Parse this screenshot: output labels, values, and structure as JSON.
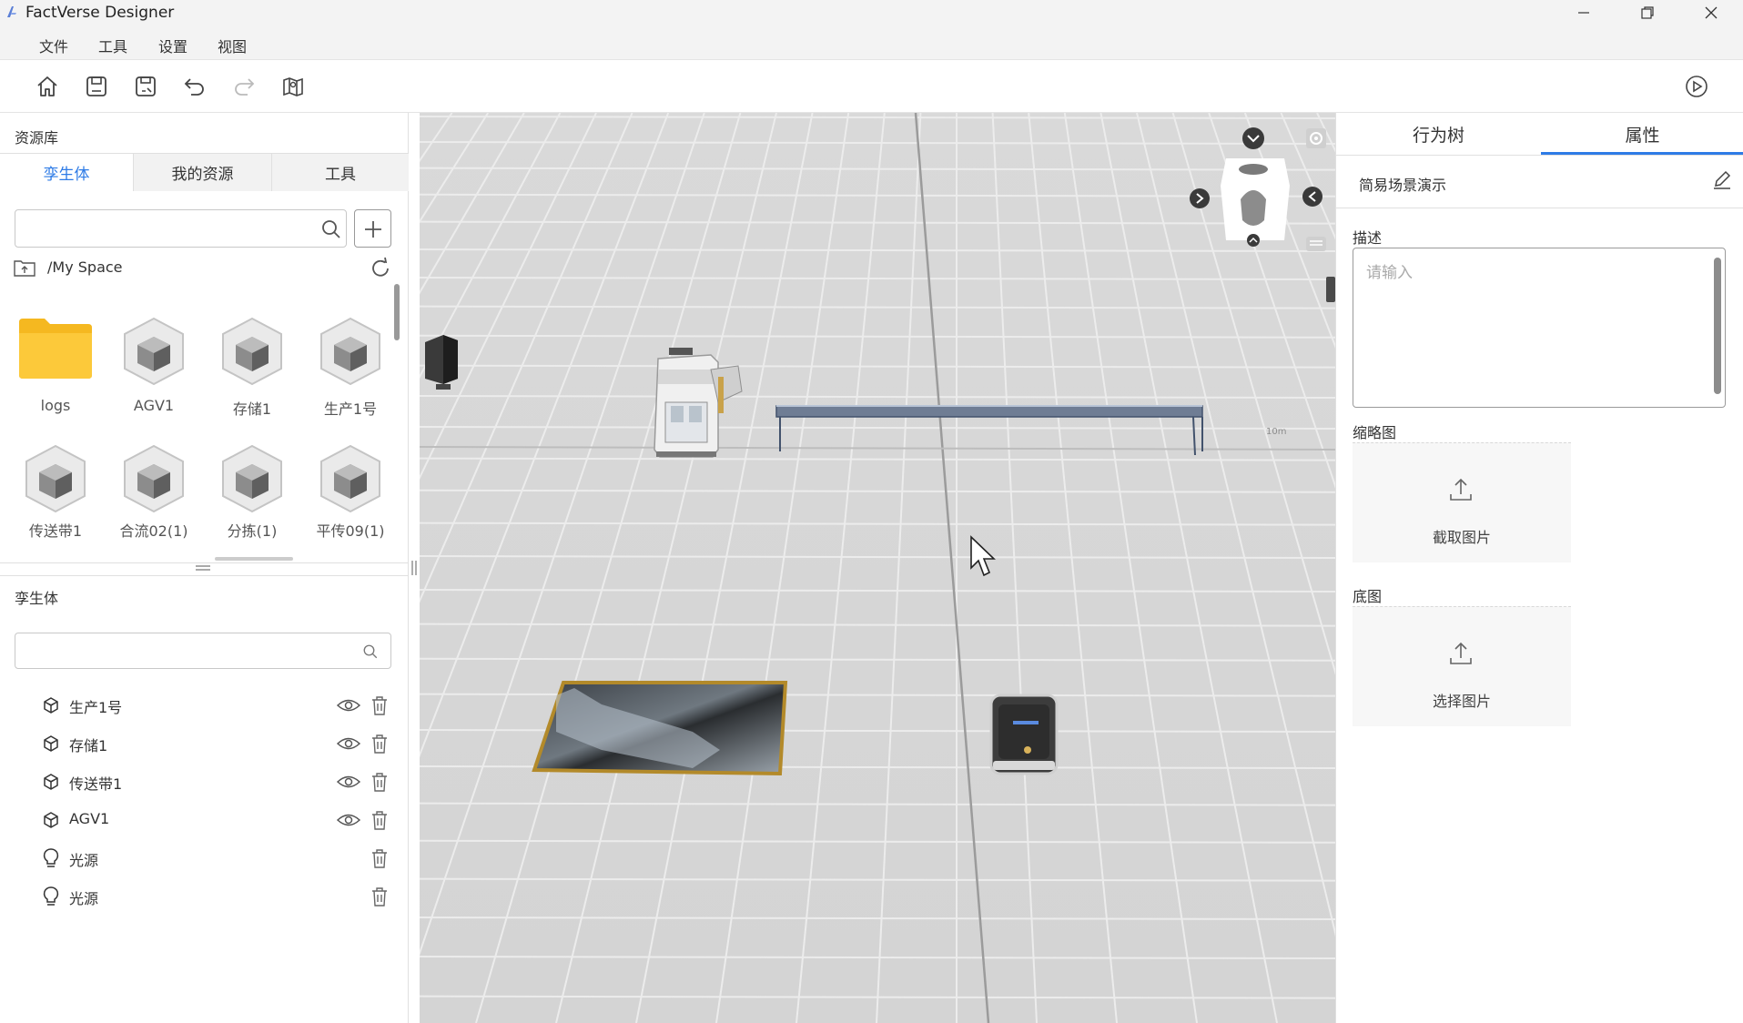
{
  "window": {
    "title": "FactVerse Designer"
  },
  "menu": {
    "items": [
      "文件",
      "工具",
      "设置",
      "视图"
    ]
  },
  "left": {
    "header": "资源库",
    "tabs": [
      "孪生体",
      "我的资源",
      "工具"
    ],
    "search_placeholder": "",
    "path": "/My Space",
    "assets": [
      {
        "label": "logs",
        "type": "folder",
        "checked": false
      },
      {
        "label": "AGV1",
        "type": "model",
        "checked": true
      },
      {
        "label": "存储1",
        "type": "model",
        "checked": true
      },
      {
        "label": "生产1号",
        "type": "model",
        "checked": true
      },
      {
        "label": "传送带1",
        "type": "model",
        "checked": true
      },
      {
        "label": "合流02(1)",
        "type": "model",
        "checked": false
      },
      {
        "label": "分拣(1)",
        "type": "model",
        "checked": false
      },
      {
        "label": "平传09(1)",
        "type": "model",
        "checked": false
      }
    ],
    "twin_header": "孪生体",
    "twin_search_placeholder": "",
    "twins": [
      {
        "label": "生产1号",
        "icon": "cube-icon",
        "visible": true
      },
      {
        "label": "存储1",
        "icon": "cube-icon",
        "visible": true
      },
      {
        "label": "传送带1",
        "icon": "cube-icon",
        "visible": true
      },
      {
        "label": "AGV1",
        "icon": "cube-icon",
        "visible": true
      },
      {
        "label": "光源",
        "icon": "lightbulb-icon",
        "visible": false
      },
      {
        "label": "光源",
        "icon": "lightbulb-icon",
        "visible": false
      }
    ]
  },
  "viewport": {
    "scale_label": "10m"
  },
  "right": {
    "tabs": [
      "行为树",
      "属性"
    ],
    "active_tab": "属性",
    "scene_name": "简易场景演示",
    "desc_label": "描述",
    "desc_placeholder": "请输入",
    "thumb_label": "缩略图",
    "thumb_button": "截取图片",
    "base_label": "底图",
    "base_button": "选择图片"
  },
  "colors": {
    "accent": "#2e7be6",
    "checkbox": "#2f6fd6",
    "folder": "#f5b820"
  }
}
